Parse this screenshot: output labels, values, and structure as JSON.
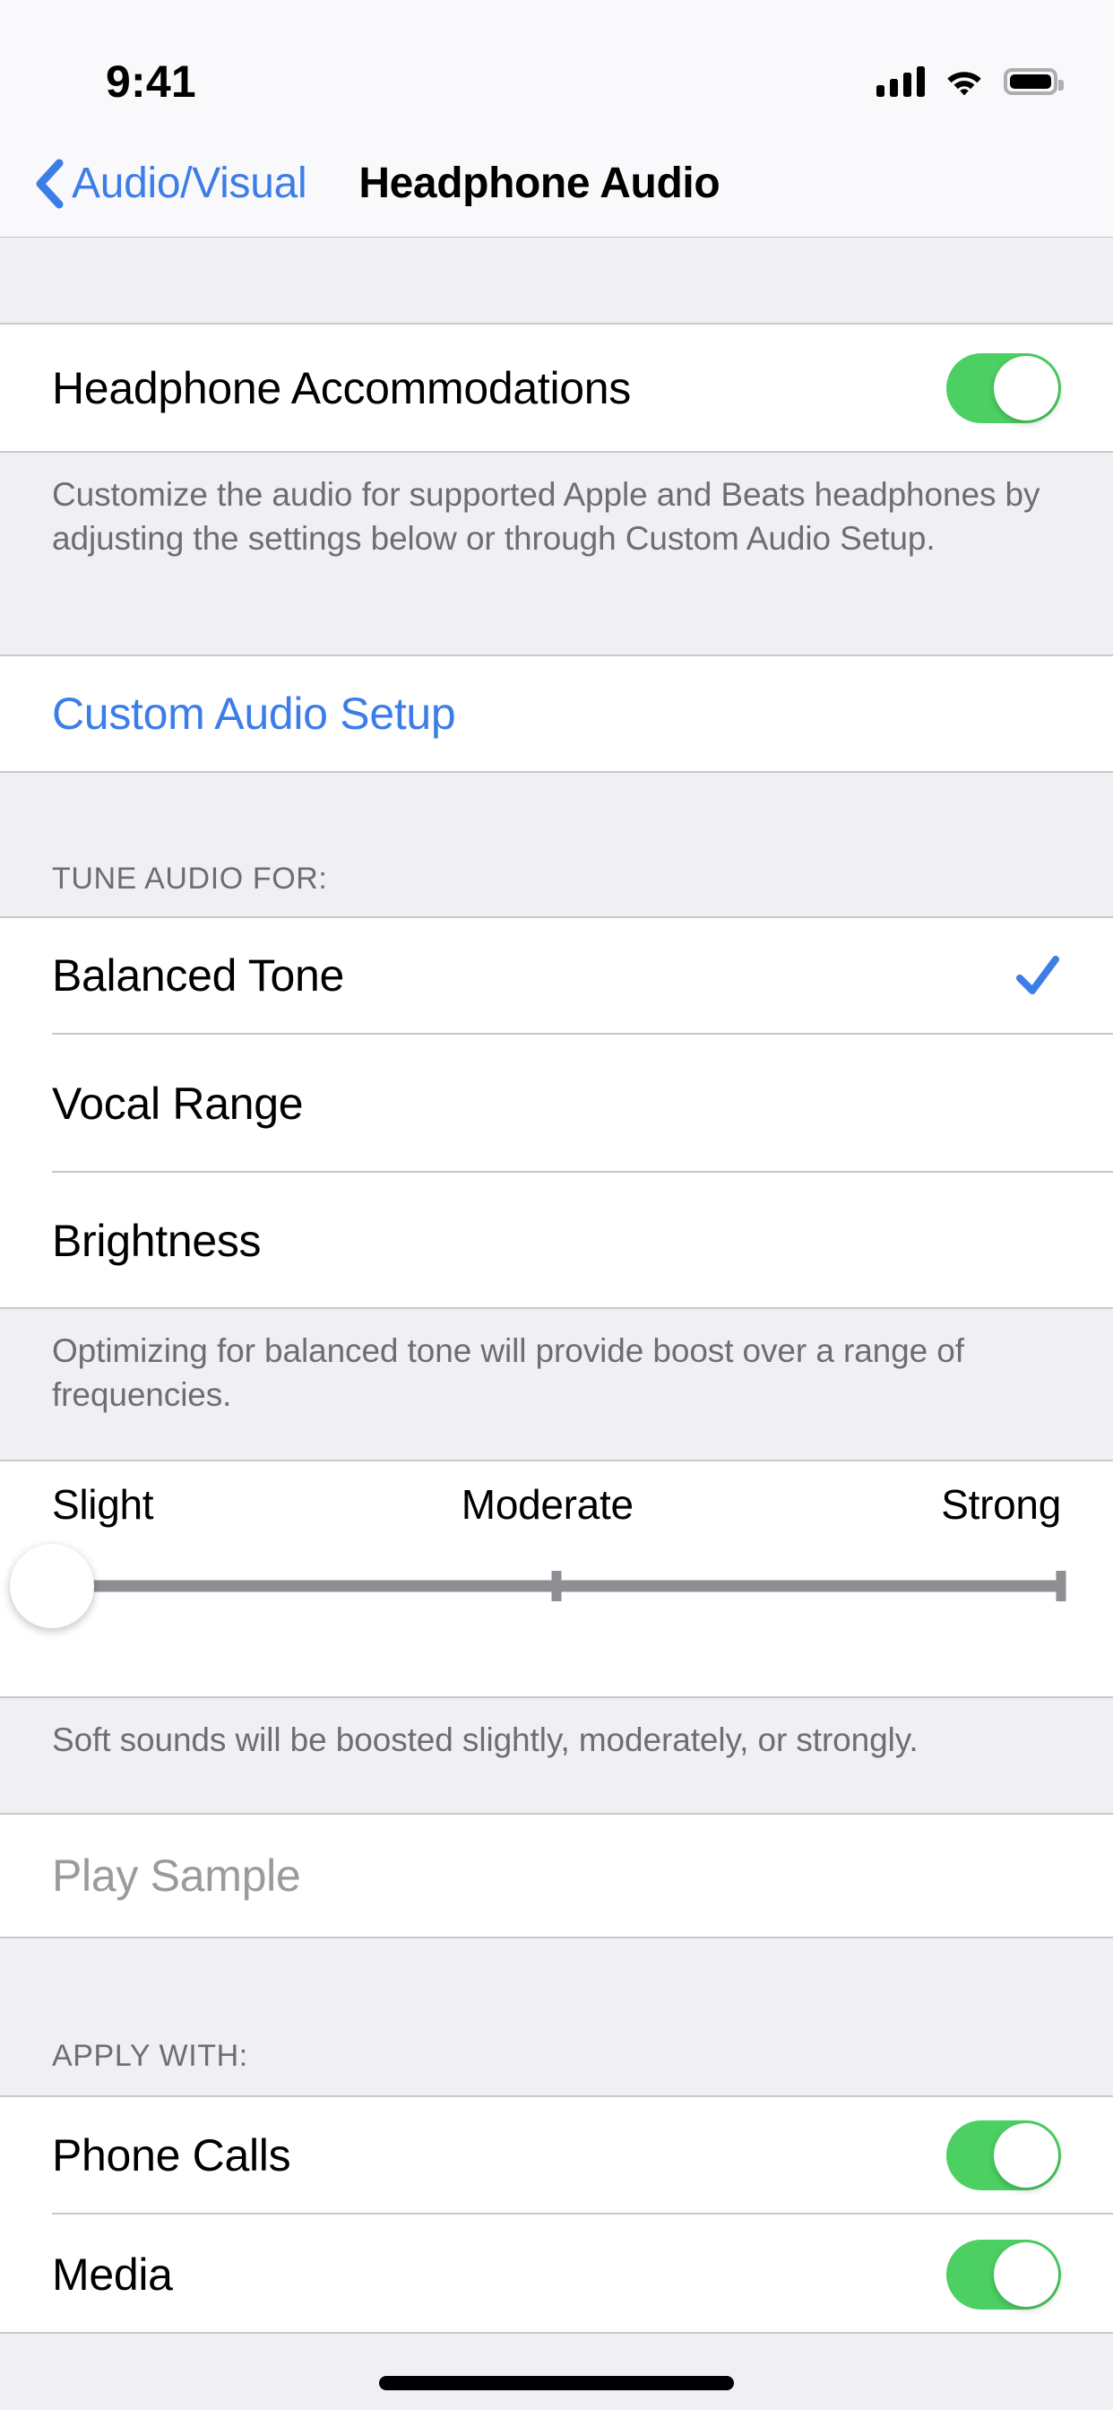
{
  "status_bar": {
    "time": "9:41",
    "cellular_icon": "cellular-signal-icon",
    "wifi_icon": "wifi-icon",
    "battery_icon": "battery-full-icon"
  },
  "nav": {
    "back_label": "Audio/Visual",
    "back_icon": "chevron-left-icon",
    "title": "Headphone Audio"
  },
  "sections": {
    "accommodations": {
      "row_label": "Headphone Accommodations",
      "toggle_state": "on",
      "footer": "Customize the audio for supported Apple and Beats headphones by adjusting the settings below or through Custom Audio Setup."
    },
    "custom_audio_setup": {
      "label": "Custom Audio Setup"
    },
    "tune_audio": {
      "header": "TUNE AUDIO FOR:",
      "options": [
        {
          "label": "Balanced Tone",
          "selected": true
        },
        {
          "label": "Vocal Range",
          "selected": false
        },
        {
          "label": "Brightness",
          "selected": false
        }
      ],
      "footer": "Optimizing for balanced tone will provide boost over a range of frequencies.",
      "check_icon": "checkmark-icon"
    },
    "strength_slider": {
      "labels": {
        "low": "Slight",
        "mid": "Moderate",
        "high": "Strong"
      },
      "value": "Slight",
      "value_percent": 0,
      "footer": "Soft sounds will be boosted slightly, moderately, or strongly."
    },
    "play_sample": {
      "label": "Play Sample",
      "enabled": false
    },
    "apply_with": {
      "header": "APPLY WITH:",
      "rows": [
        {
          "label": "Phone Calls",
          "toggle_state": "on"
        },
        {
          "label": "Media",
          "toggle_state": "on"
        }
      ]
    }
  },
  "colors": {
    "accent_blue": "#3C7DE8",
    "toggle_green": "#4CD063",
    "group_background": "#EFEFF4",
    "cell_background": "#FFFFFF",
    "secondary_text": "#6D6D72",
    "disabled_text": "#9A9A9F",
    "track_gray": "#8E8E93"
  }
}
